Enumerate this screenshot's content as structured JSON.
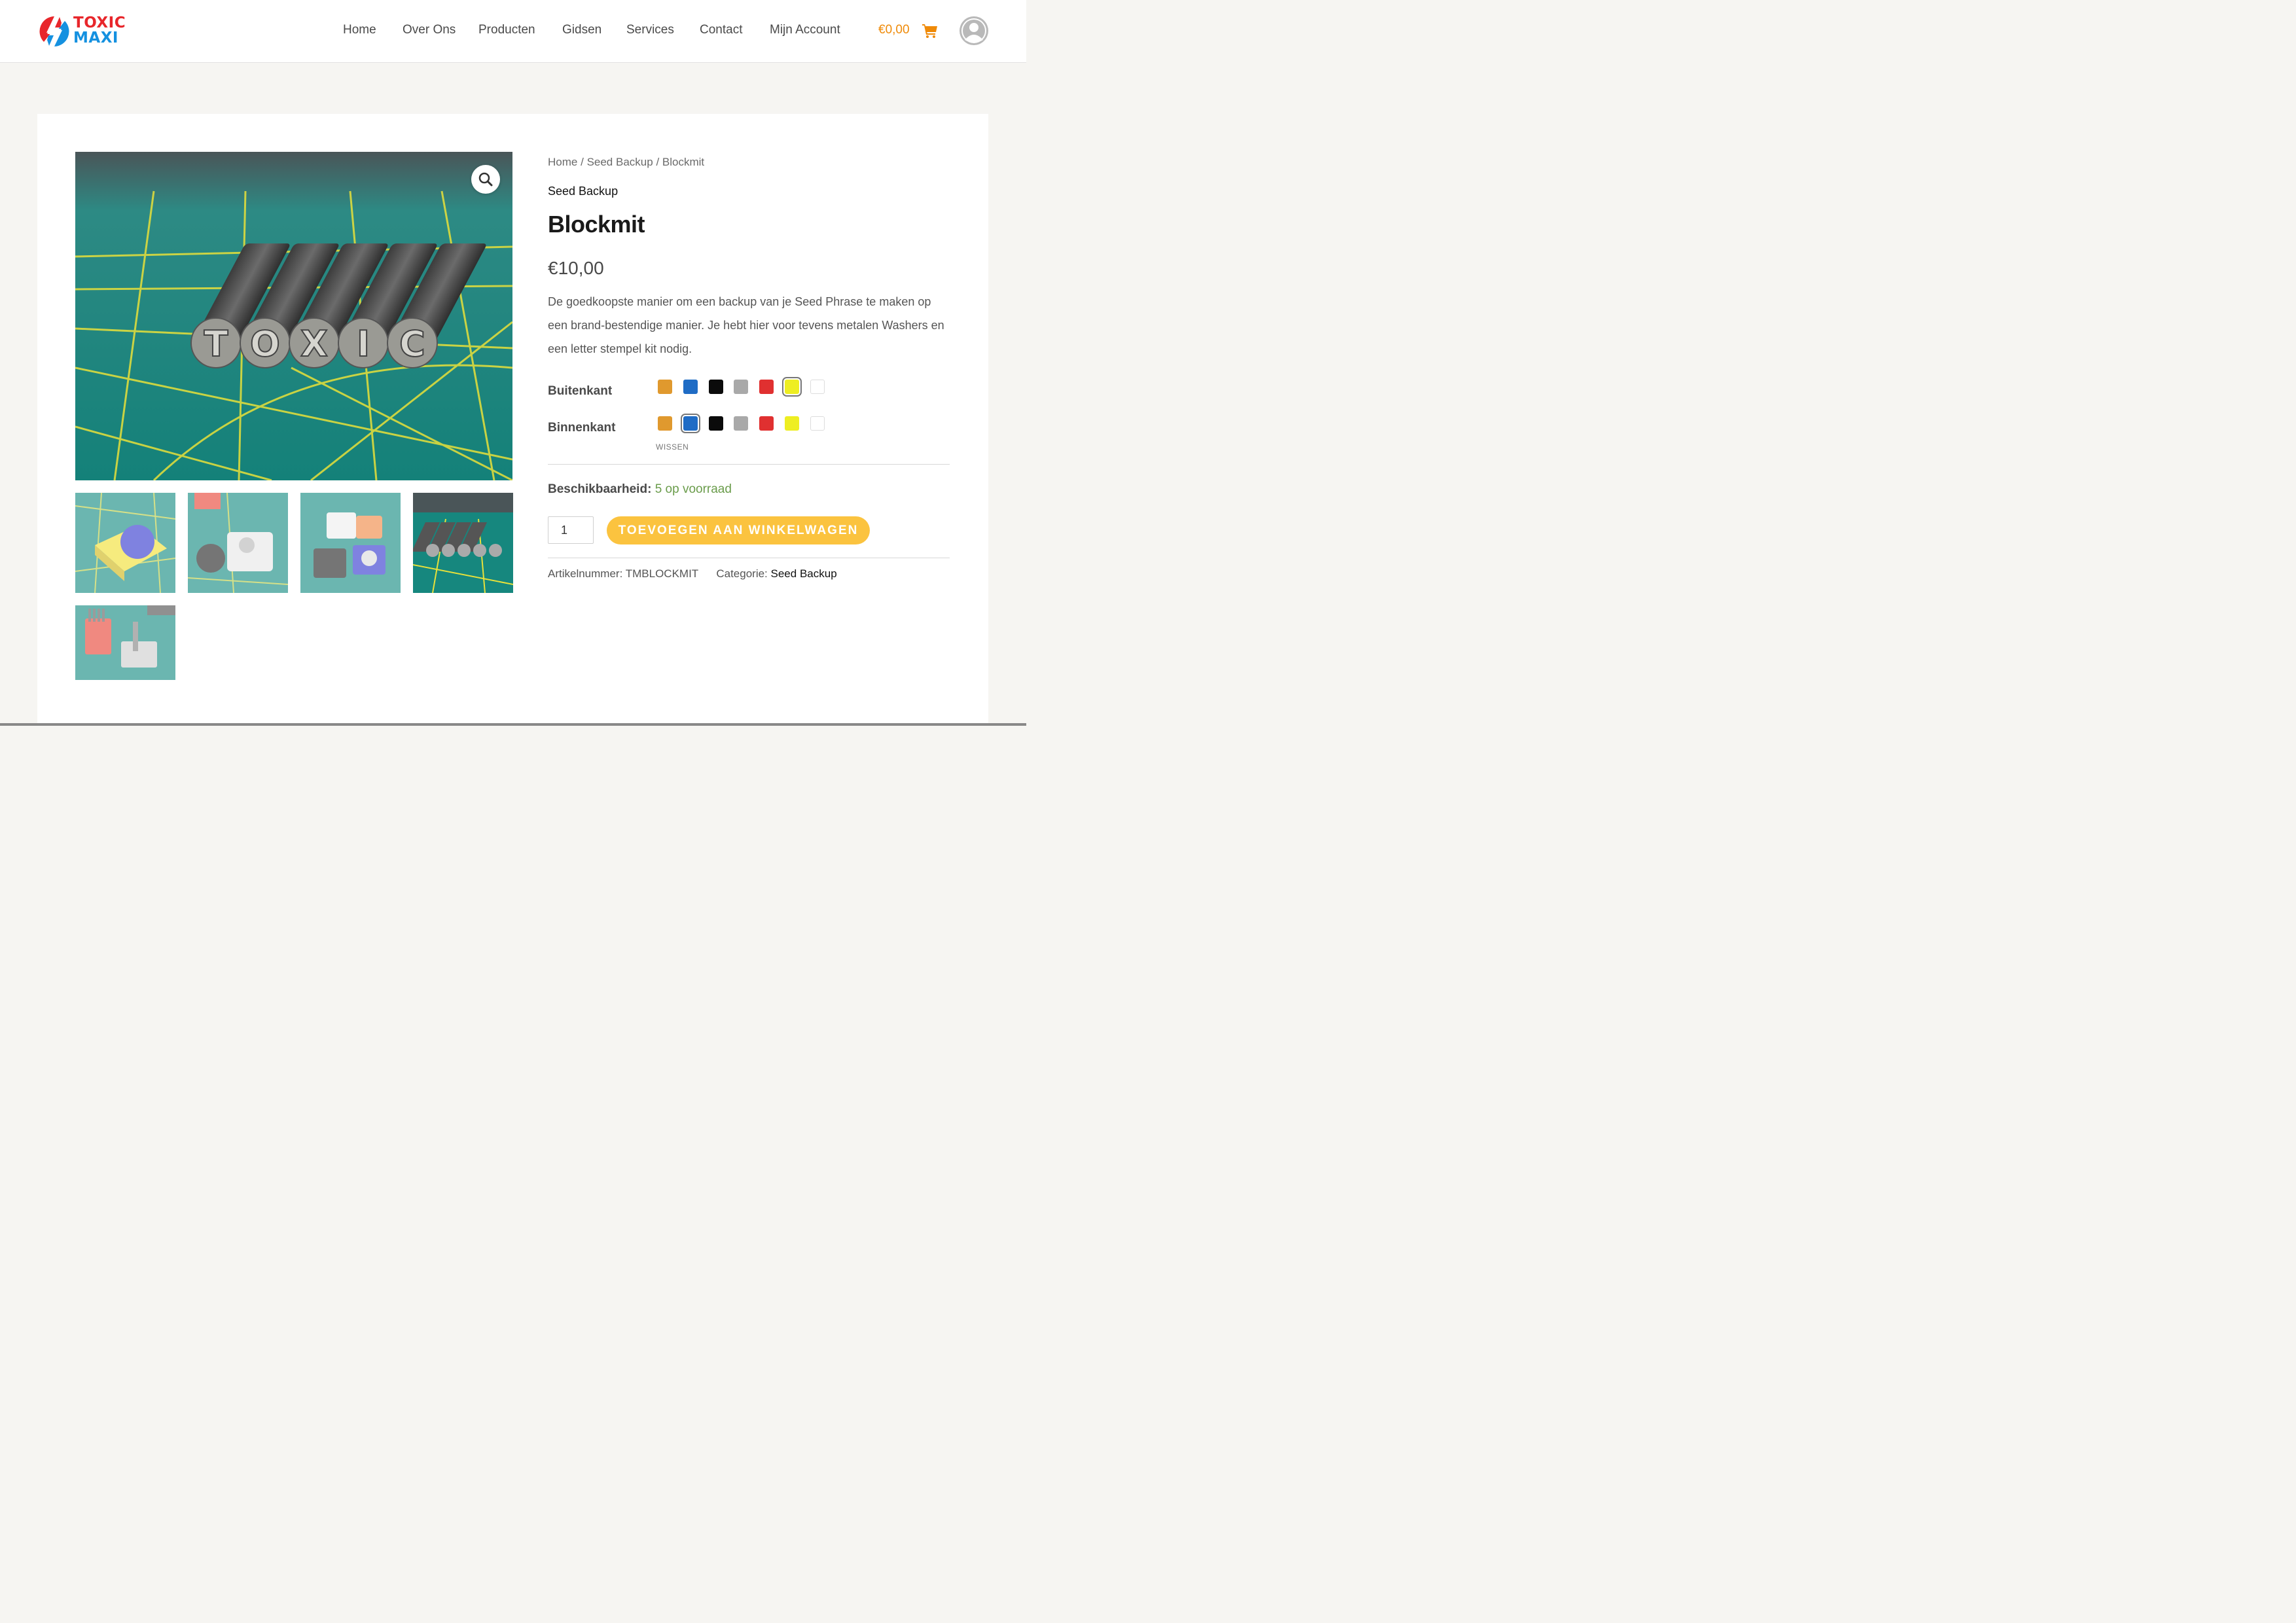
{
  "brand": {
    "line1": "TOXIC",
    "line2": "MAXI"
  },
  "nav": {
    "items": [
      "Home",
      "Over Ons",
      "Producten",
      "Gidsen",
      "Services",
      "Contact",
      "Mijn Account"
    ]
  },
  "cart": {
    "total": "€0,00"
  },
  "product": {
    "breadcrumb": [
      "Home",
      "Seed Backup",
      "Blockmit"
    ],
    "breadcrumb_sep": "/",
    "category_label": "Seed Backup",
    "title": "Blockmit",
    "price": "€10,00",
    "description": "De goedkoopste manier om een backup van je Seed Phrase te maken op een brand-bestendige manier. Je hebt hier voor tevens metalen Washers en een letter stempel kit nodig.",
    "variations": [
      {
        "label": "Buitenkant",
        "selected_index": 5
      },
      {
        "label": "Binnenkant",
        "selected_index": 1
      }
    ],
    "swatch_colors": [
      "#e0992e",
      "#1f6cc5",
      "#0b0b0b",
      "#a9a9a9",
      "#e03030",
      "#eeee22",
      "#ffffff"
    ],
    "clear_label": "WISSEN",
    "availability_label": "Beschikbaarheid:",
    "availability_value": "5 op voorraad",
    "quantity": "1",
    "add_to_cart": "TOEVOEGEN AAN WINKELWAGEN",
    "sku_label": "Artikelnummer:",
    "sku_value": "TMBLOCKMIT",
    "category_meta_label": "Categorie:",
    "category_meta_value": "Seed Backup"
  },
  "stamp_letters": [
    "T",
    "O",
    "X",
    "I",
    "C"
  ],
  "colors": {
    "accent_orange": "#ef8a08",
    "button_yellow": "#fbc33f",
    "stock_green": "#6a9c4b",
    "mat_green": "#16877e",
    "grid_yellow": "#e8e13a"
  }
}
